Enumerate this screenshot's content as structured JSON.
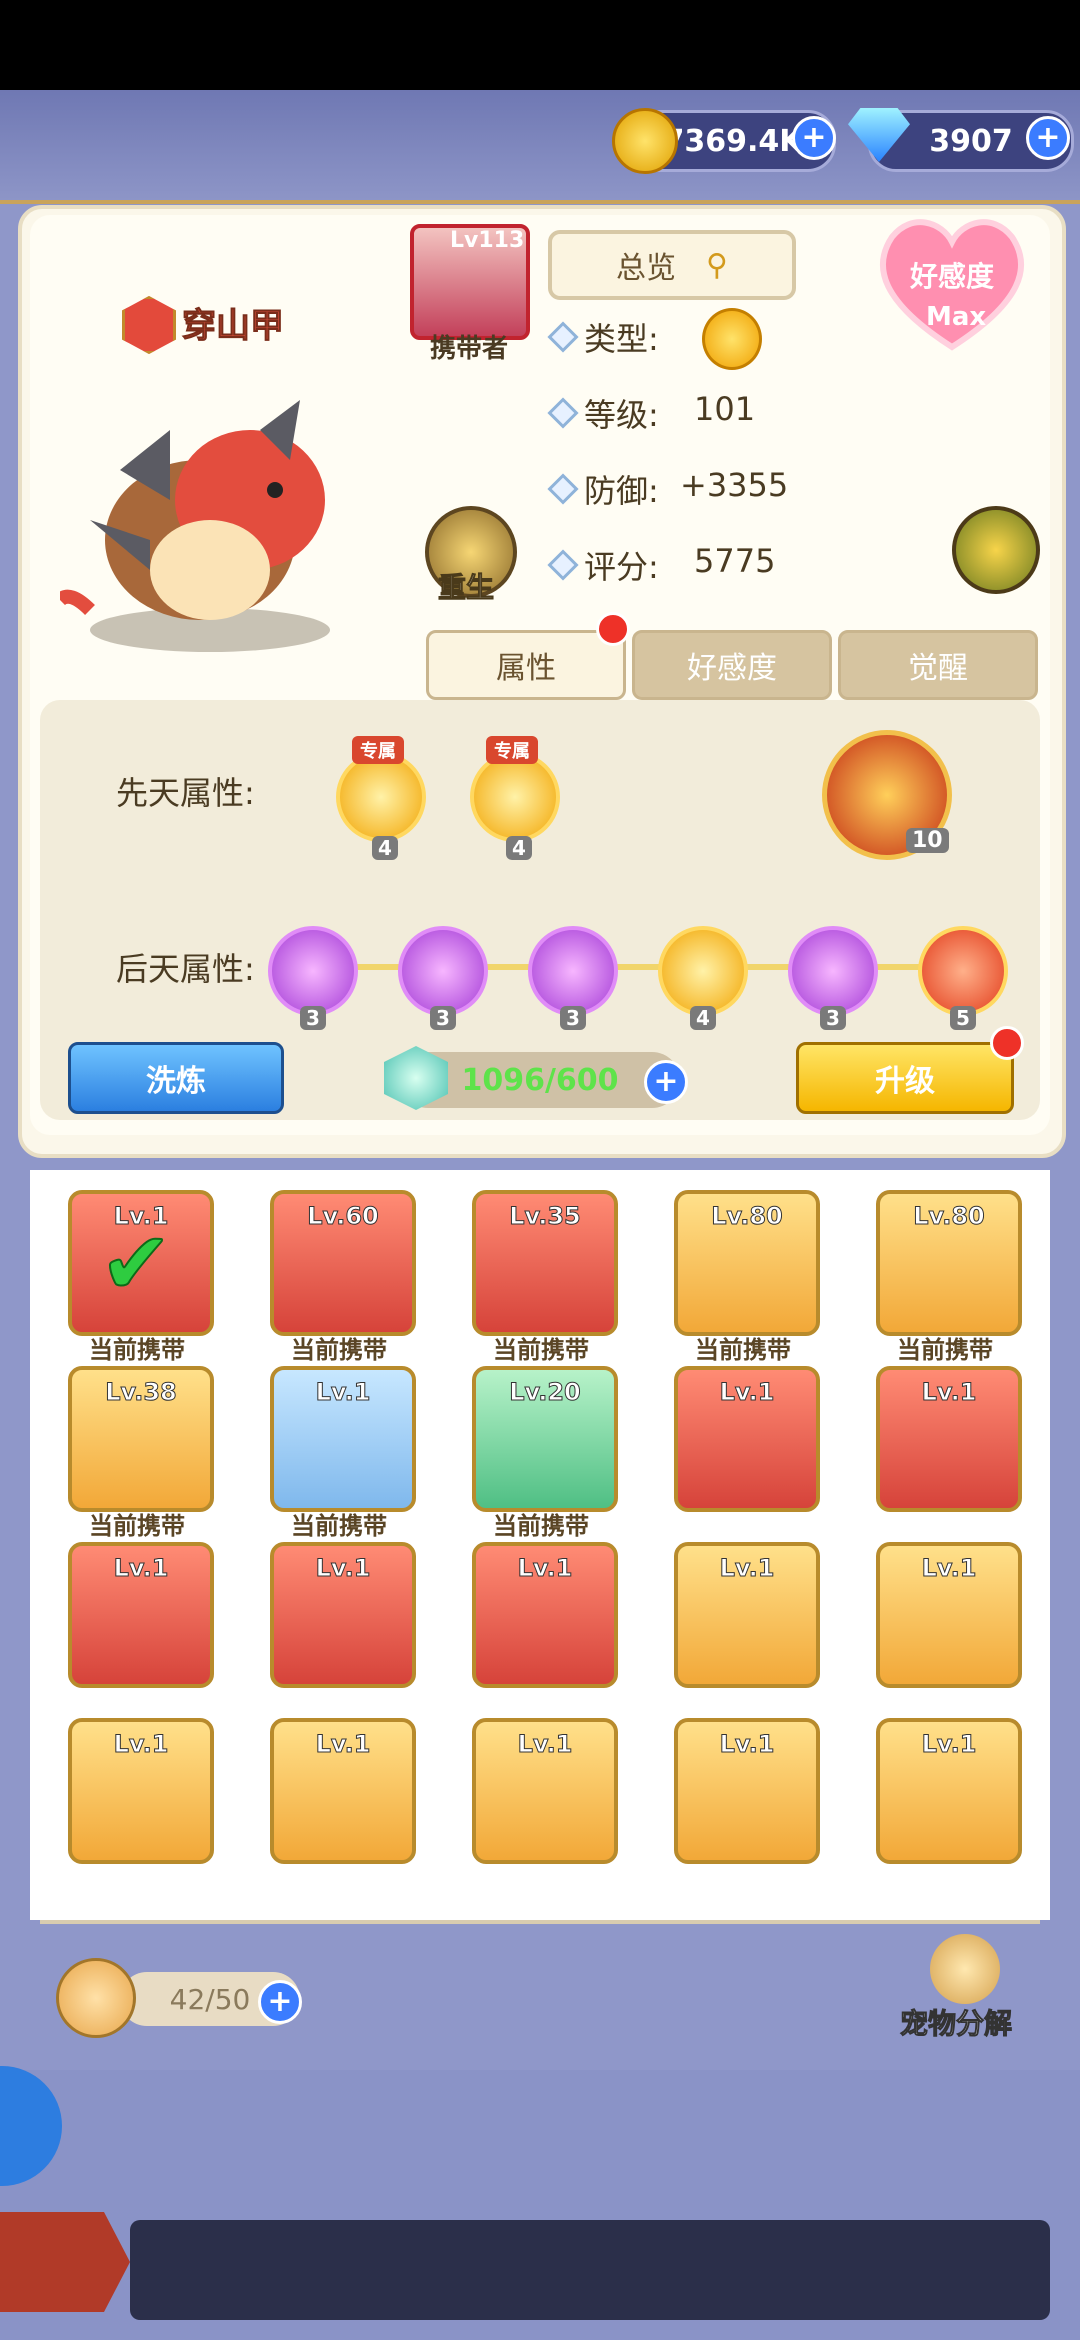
{
  "currency": {
    "gold": "7369.4K",
    "gems": "3907"
  },
  "pet": {
    "name": "穿山甲",
    "carrier_level": "Lv113",
    "carrier_label": "携带者",
    "overview": "总览",
    "affection": "好感度",
    "affection_level": "Max",
    "reborn": "重生",
    "stats": {
      "type_label": "类型:",
      "level_label": "等级:",
      "level_value": "101",
      "defense_label": "防御:",
      "defense_value": "+3355",
      "score_label": "评分:",
      "score_value": "5775"
    }
  },
  "tabs": [
    "属性",
    "好感度",
    "觉醒"
  ],
  "attributes": {
    "innate_label": "先天属性:",
    "acquired_label": "后天属性:",
    "exclusive_tag": "专属",
    "innate": [
      {
        "icon": "heart-icon",
        "count": "4"
      },
      {
        "icon": "heart-plus-icon",
        "count": "4"
      }
    ],
    "special": {
      "icon": "flame-claw-icon",
      "count": "10"
    },
    "acquired": [
      {
        "icon": "sword-icon",
        "count": "3",
        "tone": "purple"
      },
      {
        "icon": "shield-icon",
        "count": "3",
        "tone": "purple"
      },
      {
        "icon": "runner-icon",
        "count": "3",
        "tone": "purple"
      },
      {
        "icon": "slash-icon",
        "count": "4",
        "tone": "gold"
      },
      {
        "icon": "shield-ring-icon",
        "count": "3",
        "tone": "purple"
      },
      {
        "icon": "break-icon",
        "count": "5",
        "tone": "red"
      }
    ],
    "refine_button": "洗炼",
    "progress": "1096/600",
    "upgrade_button": "升级"
  },
  "pets": [
    {
      "level": "Lv.1",
      "tone": "red",
      "carry": "当前携带",
      "selected": true
    },
    {
      "level": "Lv.60",
      "tone": "red",
      "carry": "当前携带"
    },
    {
      "level": "Lv.35",
      "tone": "red",
      "carry": "当前携带"
    },
    {
      "level": "Lv.80",
      "tone": "gold",
      "carry": "当前携带"
    },
    {
      "level": "Lv.80",
      "tone": "gold",
      "carry": "当前携带"
    },
    {
      "level": "Lv.38",
      "tone": "gold",
      "carry": "当前携带"
    },
    {
      "level": "Lv.1",
      "tone": "blue",
      "carry": "当前携带"
    },
    {
      "level": "Lv.20",
      "tone": "green",
      "carry": "当前携带"
    },
    {
      "level": "Lv.1",
      "tone": "red",
      "carry": ""
    },
    {
      "level": "Lv.1",
      "tone": "red",
      "carry": ""
    },
    {
      "level": "Lv.1",
      "tone": "red",
      "carry": ""
    },
    {
      "level": "Lv.1",
      "tone": "red",
      "carry": ""
    },
    {
      "level": "Lv.1",
      "tone": "red",
      "carry": ""
    },
    {
      "level": "Lv.1",
      "tone": "gold",
      "carry": ""
    },
    {
      "level": "Lv.1",
      "tone": "gold",
      "carry": ""
    },
    {
      "level": "Lv.1",
      "tone": "gold",
      "carry": ""
    },
    {
      "level": "Lv.1",
      "tone": "gold",
      "carry": ""
    },
    {
      "level": "Lv.1",
      "tone": "gold",
      "carry": ""
    },
    {
      "level": "Lv.1",
      "tone": "gold",
      "carry": ""
    },
    {
      "level": "Lv.1",
      "tone": "gold",
      "carry": ""
    }
  ],
  "footer": {
    "pet_count": "42/50",
    "decompose": "宠物分解"
  }
}
